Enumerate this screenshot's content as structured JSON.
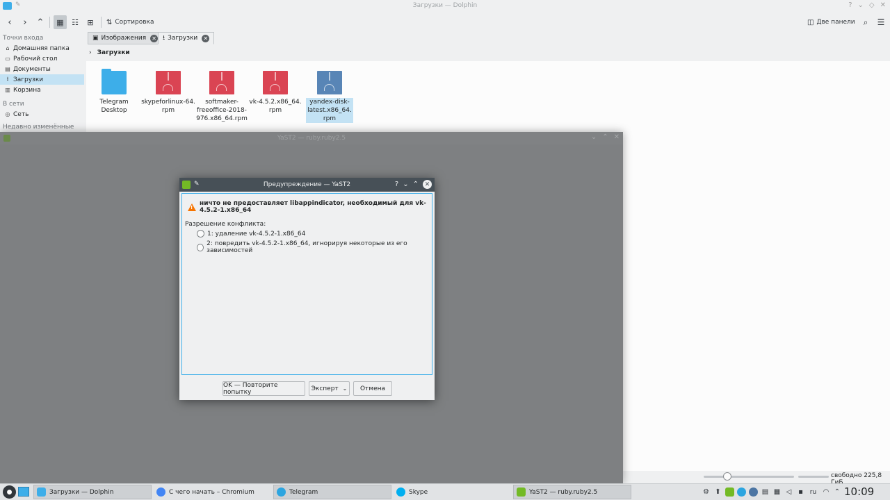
{
  "dolphin": {
    "title": "Загрузки — Dolphin",
    "toolbar": {
      "sort_label": "Сортировка",
      "split_label": "Две панели"
    },
    "sidebar": {
      "places_header": "Точки входа",
      "places": [
        {
          "label": "Домашняя папка",
          "icon": "home-icon"
        },
        {
          "label": "Рабочий стол",
          "icon": "desktop-icon"
        },
        {
          "label": "Документы",
          "icon": "documents-icon"
        },
        {
          "label": "Загрузки",
          "icon": "downloads-icon",
          "selected": true
        },
        {
          "label": "Корзина",
          "icon": "trash-icon"
        }
      ],
      "network_header": "В сети",
      "network": [
        {
          "label": "Сеть",
          "icon": "network-icon"
        }
      ],
      "recent_header": "Недавно изменённые"
    },
    "tabs": [
      {
        "label": "Изображения",
        "icon": "images-icon"
      },
      {
        "label": "Загрузки",
        "icon": "downloads-icon",
        "active": true
      }
    ],
    "breadcrumb": "Загрузки",
    "files": [
      {
        "name_lines": [
          "Telegram",
          "Desktop"
        ],
        "type": "folder"
      },
      {
        "name_lines": [
          "skypeforlinux-64.",
          "rpm"
        ],
        "type": "rpm"
      },
      {
        "name_lines": [
          "softmaker-",
          "freeoffice-2018-",
          "976.x86_64.rpm"
        ],
        "type": "rpm"
      },
      {
        "name_lines": [
          "vk-4.5.2.x86_64.",
          "rpm"
        ],
        "type": "rpm"
      },
      {
        "name_lines": [
          "yandex-disk-",
          "latest.x86_64.",
          "rpm"
        ],
        "type": "rpm",
        "selected": true
      }
    ],
    "status": {
      "free_space": "свободно 225,8 ГиБ"
    }
  },
  "yast_main": {
    "title": "YaST2 — ruby.ruby2.5"
  },
  "dialog": {
    "title": "Предупреждение — YaST2",
    "warning": "ничто не предоставляет libappindicator, необходимый для vk-4.5.2-1.x86_64",
    "resolution_label": "Разрешение конфликта:",
    "options": [
      "1: удаление vk-4.5.2-1.x86_64",
      "2: повредить vk-4.5.2-1.x86_64, игнорируя некоторые из его зависимостей"
    ],
    "buttons": {
      "ok": "OK — Повторите попытку",
      "expert": "Эксперт",
      "cancel": "Отмена"
    }
  },
  "taskbar": {
    "tasks": [
      {
        "label": "Загрузки — Dolphin",
        "icon_color": "#3daee9",
        "active": true
      },
      {
        "label": "С чего начать – Chromium",
        "icon_color": "#4285f4"
      },
      {
        "label": "Telegram",
        "icon_color": "#2ca5e0",
        "active": true
      },
      {
        "label": "Skype",
        "icon_color": "#00aff0"
      },
      {
        "label": "YaST2 — ruby.ruby2.5",
        "icon_color": "#73ba25",
        "active": true
      }
    ],
    "language": "ru",
    "clock": "10:09"
  },
  "colors": {
    "accent": "#3daee9",
    "warning": "#f67400",
    "rpm": "#da4453",
    "rpm_selected": "#5885b6"
  }
}
